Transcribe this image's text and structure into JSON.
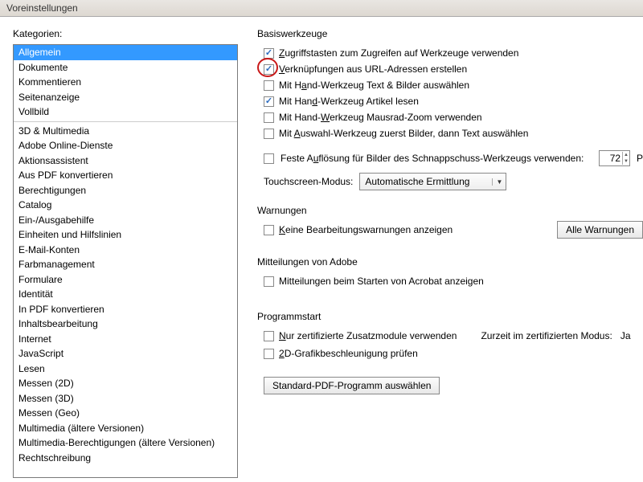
{
  "window": {
    "title": "Voreinstellungen"
  },
  "left": {
    "label": "Kategorien:",
    "selected_index": 0,
    "items": [
      "Allgemein",
      "Dokumente",
      "Kommentieren",
      "Seitenanzeige",
      "Vollbild",
      "-",
      "3D & Multimedia",
      "Adobe Online-Dienste",
      "Aktionsassistent",
      "Aus PDF konvertieren",
      "Berechtigungen",
      "Catalog",
      "Ein-/Ausgabehilfe",
      "Einheiten und Hilfslinien",
      "E-Mail-Konten",
      "Farbmanagement",
      "Formulare",
      "Identität",
      "In PDF konvertieren",
      "Inhaltsbearbeitung",
      "Internet",
      "JavaScript",
      "Lesen",
      "Messen (2D)",
      "Messen (3D)",
      "Messen (Geo)",
      "Multimedia (ältere Versionen)",
      "Multimedia-Berechtigungen (ältere Versionen)",
      "Rechtschreibung"
    ]
  },
  "basis": {
    "legend": "Basiswerkzeuge",
    "c1": {
      "checked": true,
      "html": "<u>Z</u>ugriffstasten zum Zugreifen auf Werkzeuge verwenden"
    },
    "c2": {
      "checked": true,
      "html": "<u>V</u>erknüpfungen aus URL-Adressen erstellen"
    },
    "c3": {
      "checked": false,
      "html": "Mit H<u>a</u>nd-Werkzeug Text & Bilder auswählen"
    },
    "c4": {
      "checked": true,
      "html": "Mit Han<u>d</u>-Werkzeug Artikel lesen"
    },
    "c5": {
      "checked": false,
      "html": "Mit Hand-<u>W</u>erkzeug Mausrad-Zoom verwenden"
    },
    "c6": {
      "checked": false,
      "html": "Mit <u>A</u>uswahl-Werkzeug zuerst Bilder, dann Text auswählen"
    },
    "res": {
      "checked": false,
      "html": "Feste A<u>u</u>flösung für Bilder des Schnappschuss-Werkzeugs verwenden:",
      "value": "72",
      "unit": "Pixel"
    },
    "tsmode_label": "Touchscreen-Modus:",
    "tsmode_value": "Automatische Ermittlung"
  },
  "warn": {
    "legend": "Warnungen",
    "c1": {
      "checked": false,
      "html": "<u>K</u>eine Bearbeitungswarnungen anzeigen"
    },
    "btn": "Alle Warnungen"
  },
  "adobe": {
    "legend": "Mitteilungen von Adobe",
    "c1": {
      "checked": false,
      "html": "Mitteilungen beim Starten von Acrobat anzeigen"
    }
  },
  "start": {
    "legend": "Programmstart",
    "c1": {
      "checked": false,
      "html": "<u>N</u>ur zertifizierte Zusatzmodule verwenden"
    },
    "status_label": "Zurzeit im zertifizierten Modus:",
    "status_value": "Ja",
    "c2": {
      "checked": false,
      "html": "<u>2</u>D-Grafikbeschleunigung prüfen"
    },
    "btn": "Standard-PDF-Programm auswählen"
  }
}
